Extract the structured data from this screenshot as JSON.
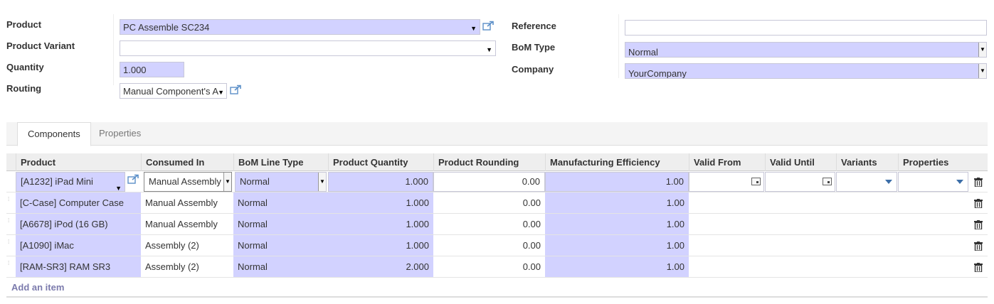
{
  "form": {
    "product_label": "Product",
    "product_value": "PC Assemble SC234",
    "variant_label": "Product Variant",
    "variant_value": "",
    "quantity_label": "Quantity",
    "quantity_value": "1.000",
    "routing_label": "Routing",
    "routing_value": "Manual Component's A",
    "reference_label": "Reference",
    "reference_value": "",
    "bom_type_label": "BoM Type",
    "bom_type_value": "Normal",
    "company_label": "Company",
    "company_value": "YourCompany"
  },
  "tabs": [
    {
      "label": "Components",
      "active": true
    },
    {
      "label": "Properties",
      "active": false
    }
  ],
  "table": {
    "columns": [
      "Product",
      "Consumed In",
      "BoM Line Type",
      "Product Quantity",
      "Product Rounding",
      "Manufacturing Efficiency",
      "Valid From",
      "Valid Until",
      "Variants",
      "Properties"
    ],
    "editing_row": {
      "product": "[A1232] iPad Mini",
      "consumed_in": "Manual Assembly",
      "line_type": "Normal",
      "quantity": "1.000",
      "rounding": "0.00",
      "efficiency": "1.00"
    },
    "rows": [
      {
        "product": "[C-Case] Computer Case",
        "consumed_in": "Manual Assembly",
        "line_type": "Normal",
        "quantity": "1.000",
        "rounding": "0.00",
        "efficiency": "1.00"
      },
      {
        "product": "[A6678] iPod (16 GB)",
        "consumed_in": "Manual Assembly",
        "line_type": "Normal",
        "quantity": "1.000",
        "rounding": "0.00",
        "efficiency": "1.00"
      },
      {
        "product": "[A1090] iMac",
        "consumed_in": "Assembly (2)",
        "line_type": "Normal",
        "quantity": "1.000",
        "rounding": "0.00",
        "efficiency": "1.00"
      },
      {
        "product": "[RAM-SR3] RAM SR3",
        "consumed_in": "Assembly (2)",
        "line_type": "Normal",
        "quantity": "2.000",
        "rounding": "0.00",
        "efficiency": "1.00"
      }
    ],
    "add_item_label": "Add an item"
  },
  "icons": {
    "external_link": "external-link-icon",
    "trash": "trash-icon",
    "calendar": "calendar-icon",
    "dropdown": "chevron-down-icon"
  },
  "colors": {
    "required_field": "#d2d2ff",
    "link": "#7c7bad",
    "header_bg": "#eeeeee"
  }
}
